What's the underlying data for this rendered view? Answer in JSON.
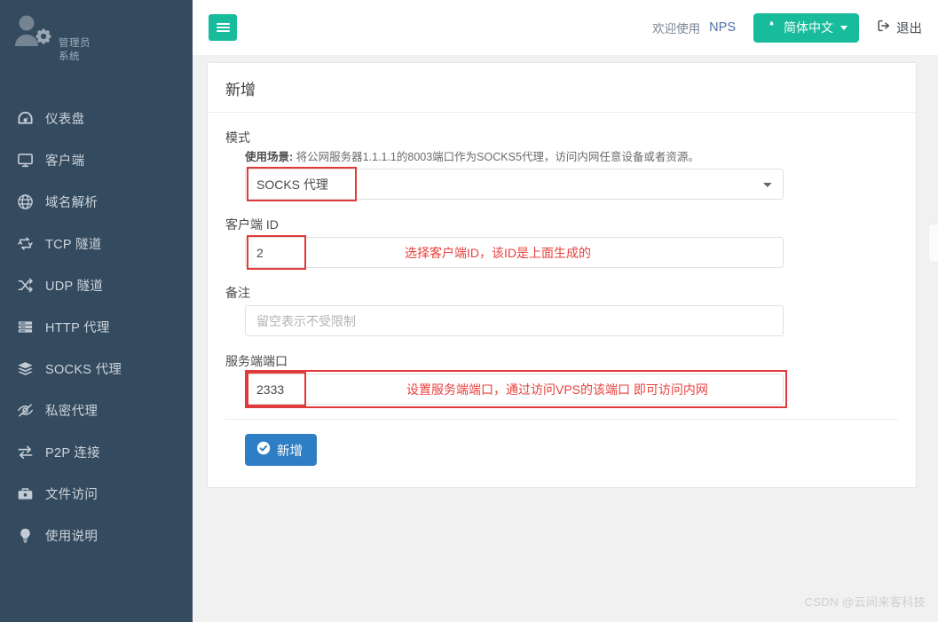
{
  "sidebar": {
    "brand": {
      "icon": "user-gear-icon",
      "line1": "管理员",
      "line2": "系统"
    },
    "items": [
      {
        "icon": "dashboard-icon",
        "label": "仪表盘"
      },
      {
        "icon": "desktop-icon",
        "label": "客户端"
      },
      {
        "icon": "globe-icon",
        "label": "域名解析"
      },
      {
        "icon": "retweet-icon",
        "label": "TCP 隧道"
      },
      {
        "icon": "shuffle-icon",
        "label": "UDP 隧道"
      },
      {
        "icon": "server-icon",
        "label": "HTTP 代理"
      },
      {
        "icon": "layers-icon",
        "label": "SOCKS 代理"
      },
      {
        "icon": "eye-slash-icon",
        "label": "私密代理"
      },
      {
        "icon": "exchange-icon",
        "label": "P2P 连接"
      },
      {
        "icon": "briefcase-icon",
        "label": "文件访问"
      },
      {
        "icon": "lightbulb-icon",
        "label": "使用说明"
      }
    ]
  },
  "topbar": {
    "menu_toggle": "menu-toggle-icon",
    "welcome": "欢迎使用",
    "product": "NPS",
    "language": "简体中文",
    "language_icon": "globe-icon",
    "logout": "退出",
    "logout_icon": "sign-out-icon",
    "accent_green": "#18bc9c"
  },
  "panel": {
    "title": "新增",
    "fields": {
      "mode": {
        "label": "模式",
        "hint_prefix": "使用场景:",
        "hint": " 将公网服务器1.1.1.1的8003端口作为SOCKS5代理，访问内网任意设备或者资源。",
        "value": "SOCKS 代理",
        "options": [
          "SOCKS 代理"
        ]
      },
      "client_id": {
        "label": "客户端 ID",
        "value": "2",
        "placeholder": ""
      },
      "remark": {
        "label": "备注",
        "value": "",
        "placeholder": "留空表示不受限制"
      },
      "server_port": {
        "label": "服务端端口",
        "value": "2333",
        "placeholder": ""
      }
    },
    "submit": {
      "label": "新增",
      "icon": "check-circle-icon",
      "color": "#2d7ec4"
    }
  },
  "annotations": {
    "color": "#e8413d",
    "client_id_note": "选择客户端ID，该ID是上面生成的",
    "server_port_note": "设置服务端端口，通过访问VPS的该端口 即可访问内网"
  },
  "watermark": "CSDN @云间来客科技"
}
